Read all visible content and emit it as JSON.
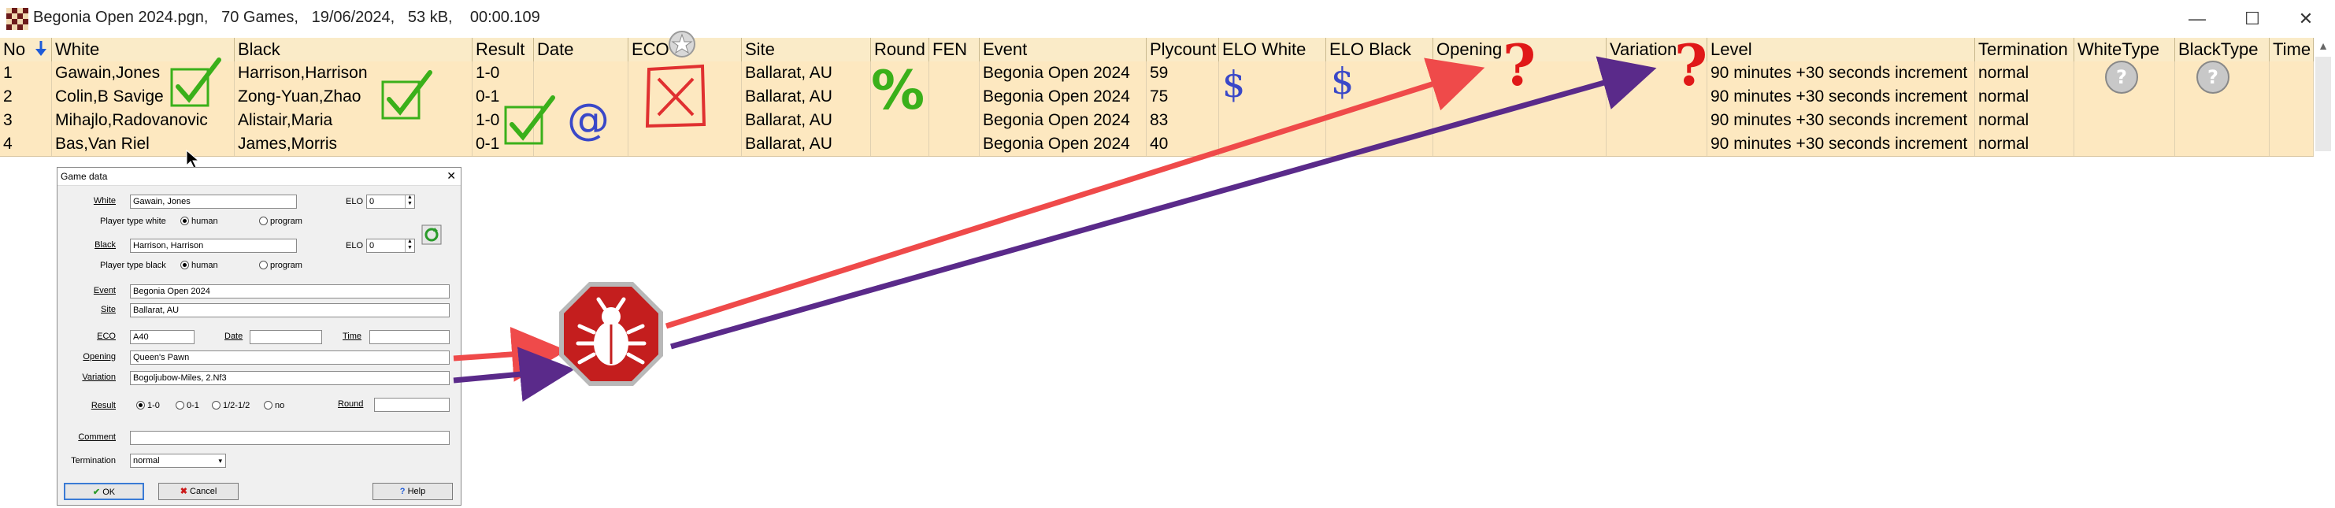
{
  "window": {
    "title": "Begonia Open 2024.pgn,   70 Games,   19/06/2024,   53 kB,    00:00.109",
    "minimize": "—",
    "maximize": "☐",
    "close": "✕"
  },
  "table": {
    "columns": [
      "No",
      "White",
      "Black",
      "Result",
      "Date",
      "ECO",
      "Site",
      "Round",
      "FEN",
      "Event",
      "Plycount",
      "ELO White",
      "ELO Black",
      "Opening",
      "Variation",
      "Level",
      "Termination",
      "WhiteType",
      "BlackType",
      "Time"
    ],
    "rows": [
      {
        "no": "1",
        "white": "Gawain,Jones",
        "black": "Harrison,Harrison",
        "result": "1-0",
        "site": "Ballarat, AU",
        "event": "Begonia Open 2024",
        "plycount": "59",
        "level": "90 minutes +30 seconds increment",
        "termination": "normal"
      },
      {
        "no": "2",
        "white": "Colin,B Savige",
        "black": "Zong-Yuan,Zhao",
        "result": "0-1",
        "site": "Ballarat, AU",
        "event": "Begonia Open 2024",
        "plycount": "75",
        "level": "90 minutes +30 seconds increment",
        "termination": "normal"
      },
      {
        "no": "3",
        "white": "Mihajlo,Radovanovic",
        "black": "Alistair,Maria",
        "result": "1-0",
        "site": "Ballarat, AU",
        "event": "Begonia Open 2024",
        "plycount": "83",
        "level": "90 minutes +30 seconds increment",
        "termination": "normal"
      },
      {
        "no": "4",
        "white": "Bas,Van Riel",
        "black": "James,Morris",
        "result": "0-1",
        "site": "Ballarat, AU",
        "event": "Begonia Open 2024",
        "plycount": "40",
        "level": "90 minutes +30 seconds increment",
        "termination": "normal"
      }
    ]
  },
  "dialog": {
    "title": "Game data",
    "close": "✕",
    "white_label": "White",
    "white_value": "Gawain, Jones",
    "elo_label": "ELO",
    "white_elo": "0",
    "player_type_white_label": "Player type white",
    "human_label": "human",
    "program_label": "program",
    "black_label": "Black",
    "black_value": "Harrison, Harrison",
    "black_elo": "0",
    "player_type_black_label": "Player type black",
    "event_label": "Event",
    "event_value": "Begonia Open 2024",
    "site_label": "Site",
    "site_value": "Ballarat, AU",
    "eco_label": "ECO",
    "eco_value": "A40",
    "date_label": "Date",
    "time_label": "Time",
    "opening_label": "Opening",
    "opening_value": "Queen's Pawn",
    "variation_label": "Variation",
    "variation_value": "Bogoljubow-Miles, 2.Nf3",
    "result_label": "Result",
    "result_options": [
      "1-0",
      "0-1",
      "1/2-1/2",
      "no"
    ],
    "round_label": "Round",
    "comment_label": "Comment",
    "termination_label": "Termination",
    "termination_value": "normal",
    "ok_label": "OK",
    "cancel_label": "Cancel",
    "help_label": "Help"
  },
  "annotations": {
    "dollar_mark": "$",
    "at_mark": "@",
    "percent_mark": "%",
    "question_mark": "?",
    "colors": {
      "red_arrow": "#ef4a4a",
      "purple_arrow": "#5a2a8a",
      "check_green": "#3ab01a",
      "bug_red": "#c41e1e"
    }
  }
}
